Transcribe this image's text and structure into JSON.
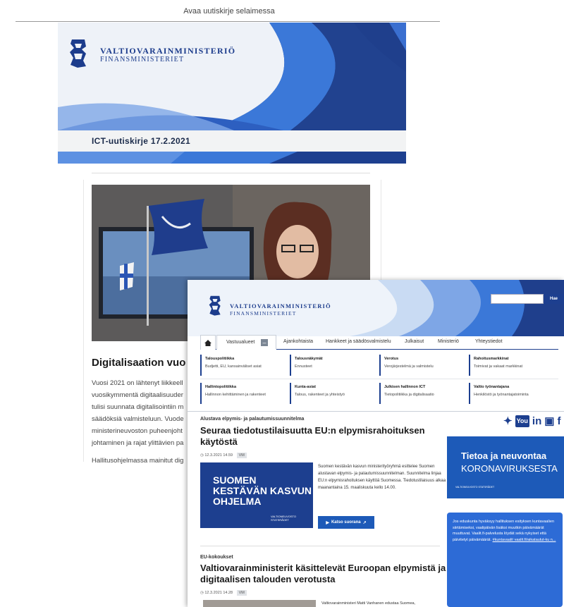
{
  "newsletter": {
    "open_in_browser": "Avaa uutiskirje selaimessa",
    "logo_main": "VALTIOVARAINMINISTERIÖ",
    "logo_sub": "FINANSMINISTERIET",
    "issue_title": "ICT-uutiskirje 17.2.2021",
    "article_heading": "Digitalisaation vuo",
    "article_paragraph1": [
      "Vuosi 2021 on lähtenyt liikkeell",
      "vuosikymmentä digitaalisuuder",
      "tulisi suunnata digitalisointiin m",
      "säädöksiä valmisteluun. Vuode",
      "ministerineuvoston puheenjoht",
      "johtaminen ja rajat ylittävien pa"
    ],
    "article_paragraph2": "Hallitusohjelmassa mainitut dig"
  },
  "website": {
    "logo_main": "VALTIOVARAINMINISTERIÖ",
    "logo_sub": "FINANSMINISTERIET",
    "search_button": "Hae",
    "nav": {
      "active": "Vastuualueet",
      "minus": "–",
      "items": [
        "Ajankohtaista",
        "Hankkeet ja säädösvalmistelu",
        "Julkaisut",
        "Ministeriö",
        "Yhteystiedot"
      ]
    },
    "mega_menu": [
      {
        "title": "Talouspolitiikka",
        "sub": "Budjetti, EU, kansainväliset asiat"
      },
      {
        "title": "Talousnäkymät",
        "sub": "Ennusteet"
      },
      {
        "title": "Verotus",
        "sub": "Verojärjestelmä ja valmistelu"
      },
      {
        "title": "Rahoitusmarkkinat",
        "sub": "Toimivat ja vakaat markkinat"
      },
      {
        "title": "Hallintopolitiikka",
        "sub": "Hallinnon kehittäminen ja rakenteet"
      },
      {
        "title": "Kunta-asiat",
        "sub": "Talous, rakenteet ja yhteistyö"
      },
      {
        "title": "Julkisen hallinnon ICT",
        "sub": "Tietopolitiikka ja digitalisaatio"
      },
      {
        "title": "Valtio työnantajana",
        "sub": "Henkilöstö ja työnantajatoiminta"
      }
    ],
    "news1": {
      "label": "Alustava elpymis- ja palautumissuunnitelma",
      "title_line1": "Seuraa tiedotustilaisuutta EU:n elpymisrahoituksen",
      "title_line2": "käytöstä",
      "date": "12.3.2021 14.59",
      "tag": "VM",
      "promo_line1": "SUOMEN",
      "promo_line2": "KESTÄVÄN KASVUN",
      "promo_line3": "OHJELMA",
      "promo_brand": "VALTIONEUVOSTO STATSRÅDET",
      "body": "Suomen kestävän kasvun ministerityöryhmä esittelee Suomen alustavan elpymis- ja palautumissuunnitelman. Suunnitelma linjaa EU:n elpymisrahoituksen käyttöä Suomessa. Tiedotustilaisuus alkaa maanantaina 15. maaliskuuta kello 14.00.",
      "button": "Katso suorana"
    },
    "news2": {
      "label": "EU-kokoukset",
      "title_line1": "Valtiovarainministerit käsittelevät Euroopan elpymistä ja",
      "title_line2": "digitaalisen talouden verotusta",
      "date": "12.3.2021 14.28",
      "tag": "VM",
      "body": "Valtiovarainministeri Matti Vanhanen edustaa Suomea,"
    },
    "social": [
      "twitter-icon",
      "youtube-icon",
      "linkedin-icon",
      "instagram-icon",
      "facebook-icon"
    ],
    "corona": {
      "line1": "Tietoa ja neuvontaa",
      "line2": "KORONAVIRUKSESTA",
      "brand": "VALTIONEUVOSTO STATSRÅDET"
    },
    "tweet": {
      "text": "Jos eduskunta hyväksyy hallituksen esityksen kuntavaalien siirtämiseksi, vaalipäivän lisäksi muutkin päivämäärät muuttuvat. Vaalit.fi-palvelusta löydät sekä nykyiset että päivitetyt päivämäärät.",
      "links": "#kuntavaalit vaalit.fi/aikataulut-ku n..."
    }
  },
  "colors": {
    "brand": "#1d3f8f",
    "accent": "#1d5ab8",
    "tweet": "#2d6bd6"
  }
}
